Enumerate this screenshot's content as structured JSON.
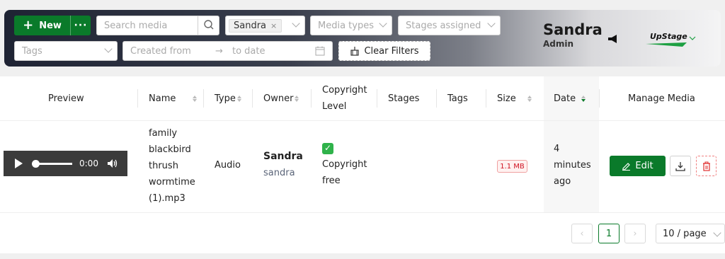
{
  "toolbar": {
    "new_label": "New",
    "more_label": "···",
    "search_placeholder": "Search media",
    "owner_chip": "Sandra",
    "owner_chip_remove": "×",
    "media_types_placeholder": "Media types",
    "stages_placeholder": "Stages assigned",
    "tags_placeholder": "Tags",
    "date_from_placeholder": "Created from",
    "date_arrow": "→",
    "date_to_placeholder": "to date",
    "clear_filters_label": "Clear Filters"
  },
  "user": {
    "name": "Sandra",
    "role": "Admin"
  },
  "logo_text": "UpStage",
  "table": {
    "headers": {
      "preview": "Preview",
      "name": "Name",
      "type": "Type",
      "owner": "Owner",
      "copyright_line1": "Copyright",
      "copyright_line2": "Level",
      "stages": "Stages",
      "tags": "Tags",
      "size": "Size",
      "date": "Date",
      "manage": "Manage Media"
    },
    "row": {
      "name_lines": [
        "family",
        "blackbird",
        "thrush",
        "wormtime",
        "(1).mp3"
      ],
      "type": "Audio",
      "owner_name": "Sandra",
      "owner_username": "sandra",
      "copyright_icon": "check-icon",
      "copyright_line1": "Copyright",
      "copyright_line2": "free",
      "size": "1.1 MB",
      "date_lines": [
        "4",
        "minutes",
        "ago"
      ],
      "audio_time": "0:00",
      "audio_progress": 0,
      "edit_label": "Edit"
    }
  },
  "pagination": {
    "prev": "‹",
    "current": "1",
    "next": "›",
    "page_size": "10 / page"
  },
  "colors": {
    "primary_green": "#0a7a2a",
    "danger_red": "#cf1322"
  }
}
